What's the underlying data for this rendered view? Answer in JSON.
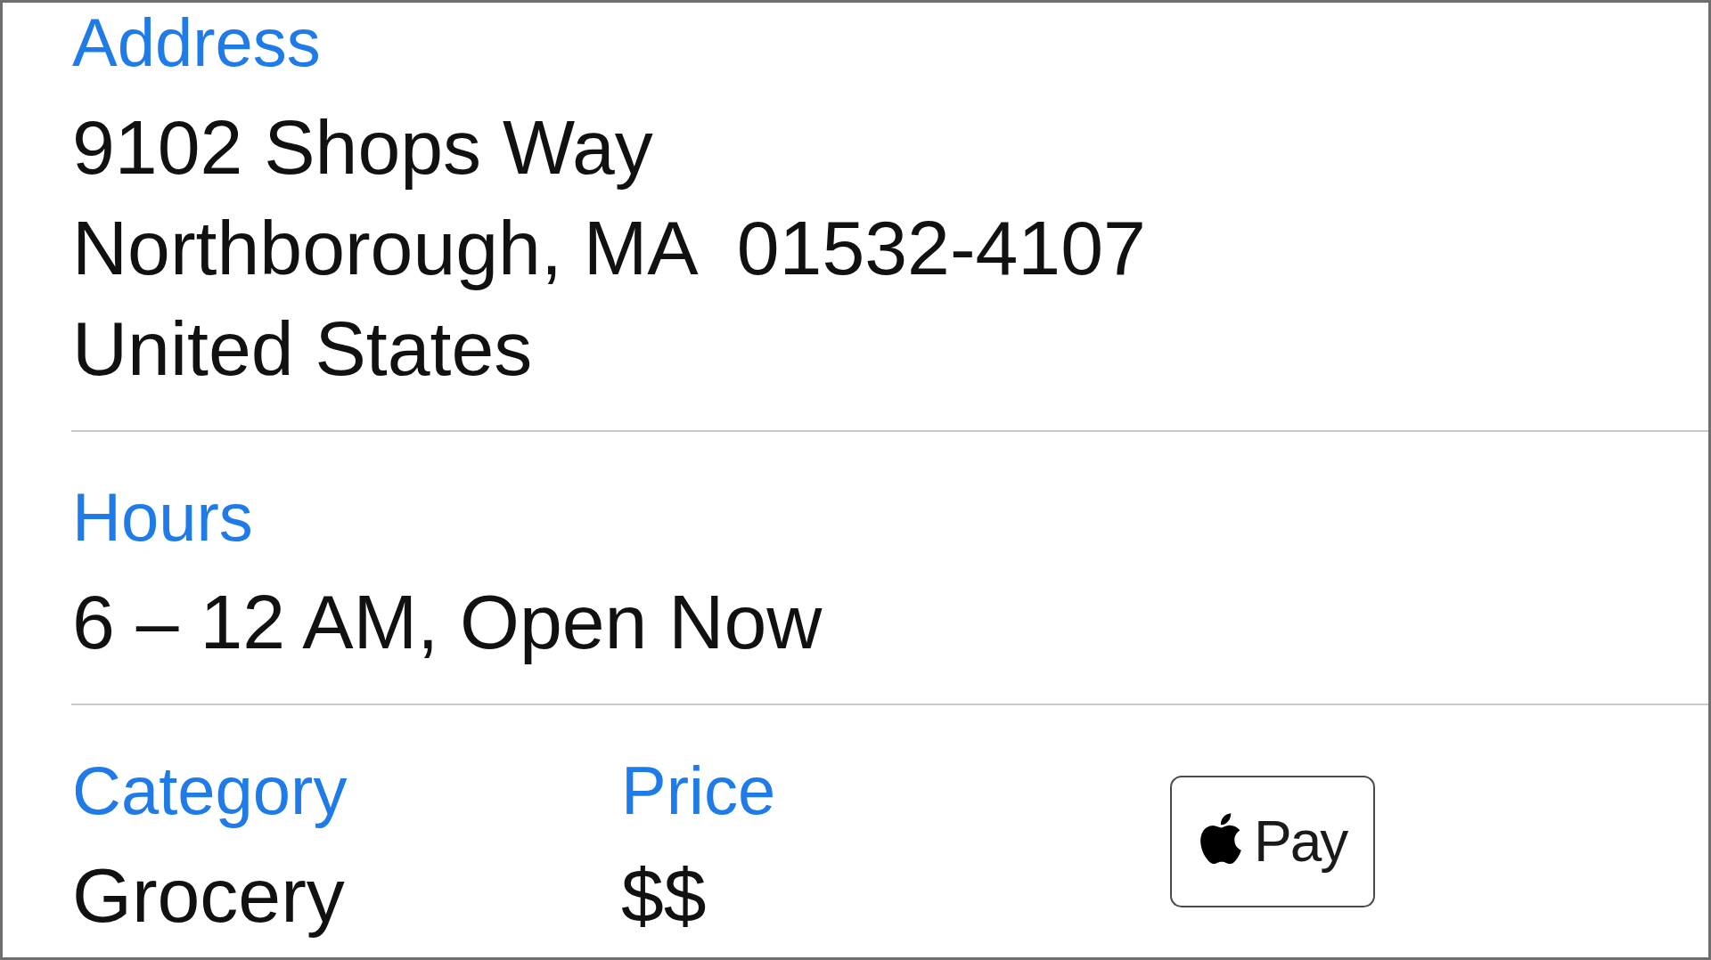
{
  "address": {
    "label": "Address",
    "lines": [
      "9102 Shops Way",
      "Northborough, MA  01532-4107",
      "United States"
    ]
  },
  "hours": {
    "label": "Hours",
    "value": "6 – 12 AM, Open Now"
  },
  "details": [
    {
      "label": "Category",
      "value": "Grocery"
    },
    {
      "label": "Price",
      "value": "$$"
    }
  ],
  "payment_badge": {
    "text": "Pay"
  }
}
